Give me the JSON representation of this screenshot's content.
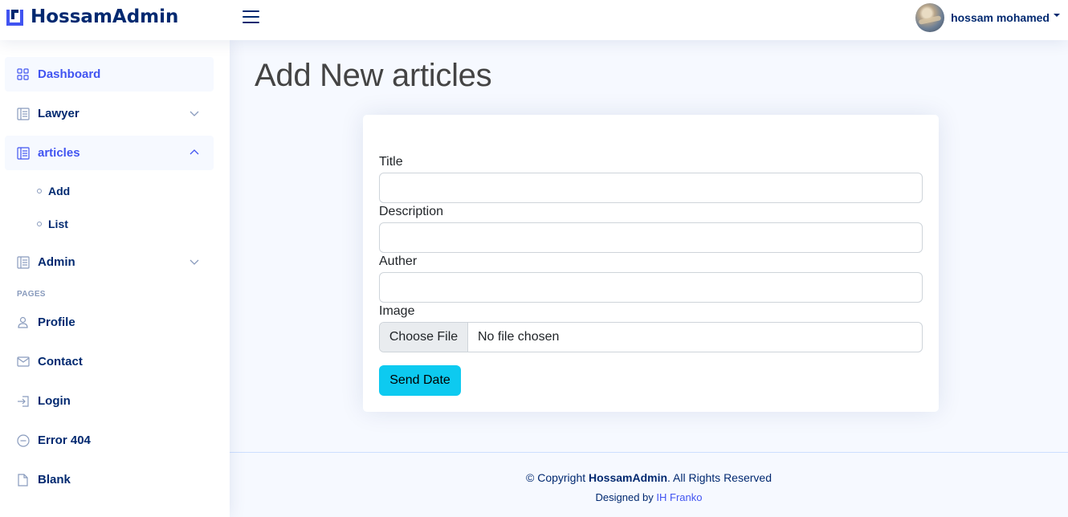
{
  "header": {
    "brand": "HossamAdmin",
    "user_name": "hossam mohamed"
  },
  "sidebar": {
    "items": [
      {
        "label": "Dashboard",
        "icon": "grid-icon"
      },
      {
        "label": "Lawyer",
        "icon": "layout-text-icon"
      },
      {
        "label": "articles",
        "icon": "layout-text-icon"
      },
      {
        "label": "Admin",
        "icon": "layout-text-icon"
      }
    ],
    "sub_items": [
      {
        "label": "Add"
      },
      {
        "label": "List"
      }
    ],
    "heading": "Pages",
    "pages": [
      {
        "label": "Profile",
        "icon": "person-icon"
      },
      {
        "label": "Contact",
        "icon": "envelope-icon"
      },
      {
        "label": "Login",
        "icon": "box-arrow-in-icon"
      },
      {
        "label": "Error 404",
        "icon": "dash-circle-icon"
      },
      {
        "label": "Blank",
        "icon": "file-icon"
      }
    ]
  },
  "main": {
    "title": "Add New articles",
    "form": {
      "title_label": "Title",
      "title_value": "",
      "description_label": "Description",
      "description_value": "",
      "auther_label": "Auther",
      "auther_value": "",
      "image_label": "Image",
      "file_button": "Choose File",
      "file_status": "No file chosen",
      "submit_label": "Send Date"
    }
  },
  "footer": {
    "copyright_prefix": "© Copyright ",
    "copyright_brand": "HossamAdmin",
    "copyright_suffix": ". All Rights Reserved",
    "designed_by": "Designed by ",
    "designer": "IH Franko"
  },
  "colors": {
    "primary": "#4154f1",
    "navy": "#012970",
    "info_button": "#0dcaf0",
    "background": "#f6f9ff"
  }
}
